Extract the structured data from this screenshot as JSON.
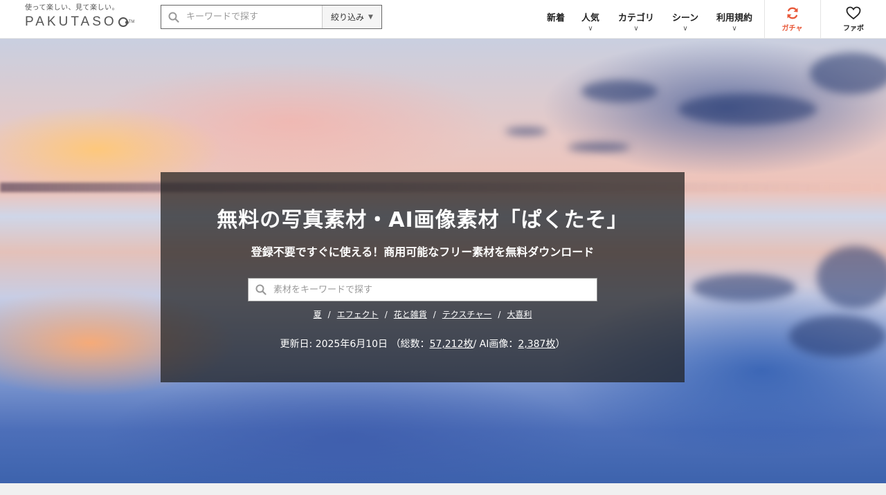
{
  "header": {
    "tagline": "使って楽しい、見て楽しい。",
    "logo_text": "PAKUTASO",
    "logo_tm": "TM",
    "search_placeholder": "キーワードで探す",
    "filter_label": "絞り込み",
    "nav": [
      {
        "label": "新着",
        "dropdown": false
      },
      {
        "label": "人気",
        "dropdown": true
      },
      {
        "label": "カテゴリ",
        "dropdown": true
      },
      {
        "label": "シーン",
        "dropdown": true
      },
      {
        "label": "利用規約",
        "dropdown": true
      }
    ],
    "gacha_label": "ガチャ",
    "fav_label": "ファボ",
    "accent_color": "#e8593a"
  },
  "hero": {
    "title": "無料の写真素材・AI画像素材「ぱくたそ」",
    "subtitle": "登録不要ですぐに使える！商用可能なフリー素材を無料ダウンロード",
    "search_placeholder": "素材をキーワードで探す",
    "tags": [
      "夏",
      "エフェクト",
      "花と雑貨",
      "テクスチャー",
      "大喜利"
    ],
    "tag_separator": "/",
    "stats": {
      "updated_prefix": "更新日: 2025年6月10日 （総数：",
      "total_count": "57,212枚",
      "ai_prefix": "/ AI画像：",
      "ai_count": "2,387枚",
      "suffix": "）"
    }
  }
}
